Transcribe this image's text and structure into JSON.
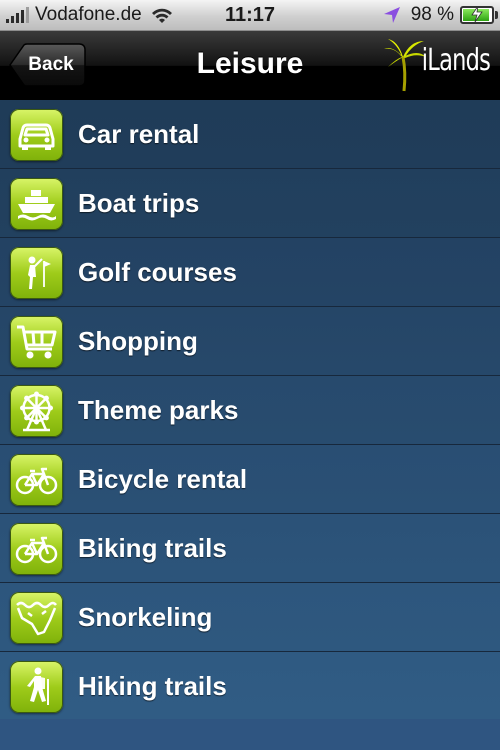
{
  "status_bar": {
    "carrier": "Vodafone.de",
    "time": "11:17",
    "battery_percent": "98 %",
    "signal_bars": 4,
    "icons": [
      "signal-icon",
      "wifi-icon",
      "location-icon",
      "battery-charging-icon"
    ]
  },
  "nav": {
    "back_label": "Back",
    "title": "Leisure",
    "logo_text": "iLands",
    "logo_icon": "palm-tree-icon"
  },
  "colors": {
    "icon_green": "#9fcc1a",
    "row_dark": "#1f3c58",
    "row_light": "#2c4f76",
    "nav_black": "#000000"
  },
  "items": [
    {
      "label": "Car rental",
      "icon": "car-icon"
    },
    {
      "label": "Boat trips",
      "icon": "boat-icon"
    },
    {
      "label": "Golf courses",
      "icon": "golfer-icon"
    },
    {
      "label": "Shopping",
      "icon": "shopping-cart-icon"
    },
    {
      "label": "Theme parks",
      "icon": "ferris-wheel-icon"
    },
    {
      "label": "Bicycle rental",
      "icon": "bicycle-icon"
    },
    {
      "label": "Biking trails",
      "icon": "bicycle-icon"
    },
    {
      "label": "Snorkeling",
      "icon": "snorkel-coast-icon"
    },
    {
      "label": "Hiking trails",
      "icon": "hiker-icon"
    }
  ]
}
